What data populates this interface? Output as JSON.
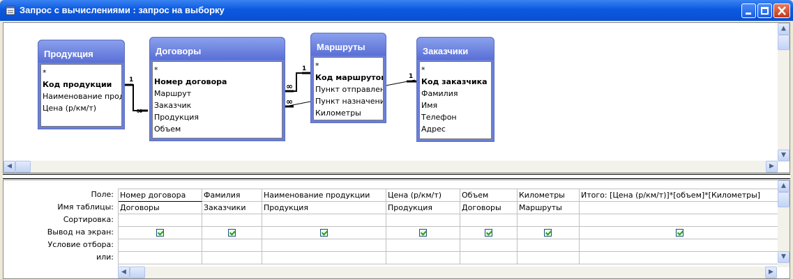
{
  "window": {
    "title": "Запрос с вычислениями : запрос на выборку",
    "colors": {
      "titlebar": "#0c59e0",
      "table_header": "#6b7fd7"
    }
  },
  "tables": [
    {
      "name": "Продукция",
      "fields": [
        "*",
        "Код продукции",
        "Наименование продукции",
        "Цена (р/км/т)"
      ],
      "key_index": 1
    },
    {
      "name": "Договоры",
      "fields": [
        "*",
        "Номер договора",
        "Маршрут",
        "Заказчик",
        "Продукция",
        "Объем"
      ],
      "key_index": 1
    },
    {
      "name": "Маршруты",
      "fields": [
        "*",
        "Код маршрутов",
        "Пункт отправления",
        "Пункт назначения",
        "Километры"
      ],
      "key_index": 1
    },
    {
      "name": "Заказчики",
      "fields": [
        "*",
        "Код заказчика",
        "Фамилия",
        "Имя",
        "Телефон",
        "Адрес"
      ],
      "key_index": 1
    }
  ],
  "relations": {
    "one": "1",
    "many": "∞"
  },
  "row_labels": [
    "Поле:",
    "Имя таблицы:",
    "Сортировка:",
    "Вывод на экран:",
    "Условие отбора:",
    "или:"
  ],
  "columns": [
    {
      "field": "Номер договора",
      "table": "Договоры",
      "show": true
    },
    {
      "field": "Фамилия",
      "table": "Заказчики",
      "show": true
    },
    {
      "field": "Наименование продукции",
      "table": "Продукция",
      "show": true
    },
    {
      "field": "Цена (р/км/т)",
      "table": "Продукция",
      "show": true
    },
    {
      "field": "Объем",
      "table": "Договоры",
      "show": true
    },
    {
      "field": "Километры",
      "table": "Маршруты",
      "show": true
    },
    {
      "field": "Итого: [Цена (р/км/т)]*[объем]*[Километры]",
      "table": "",
      "show": true
    }
  ]
}
